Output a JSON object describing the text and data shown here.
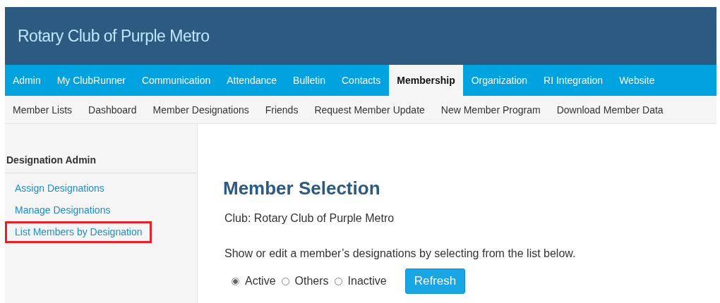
{
  "header": {
    "title": "Rotary Club of Purple Metro"
  },
  "nav": [
    {
      "label": "Admin",
      "selected": false
    },
    {
      "label": "My ClubRunner",
      "selected": false
    },
    {
      "label": "Communication",
      "selected": false
    },
    {
      "label": "Attendance",
      "selected": false
    },
    {
      "label": "Bulletin",
      "selected": false
    },
    {
      "label": "Contacts",
      "selected": false
    },
    {
      "label": "Membership",
      "selected": true
    },
    {
      "label": "Organization",
      "selected": false
    },
    {
      "label": "RI Integration",
      "selected": false
    },
    {
      "label": "Website",
      "selected": false
    }
  ],
  "subnav": [
    "Member Lists",
    "Dashboard",
    "Member Designations",
    "Friends",
    "Request Member Update",
    "New Member Program",
    "Download Member Data"
  ],
  "sidebar": {
    "heading": "Designation Admin",
    "items": [
      {
        "label": "Assign Designations",
        "highlighted": false
      },
      {
        "label": "Manage Designations",
        "highlighted": false
      },
      {
        "label": "List Members by Designation",
        "highlighted": true
      }
    ]
  },
  "main": {
    "title": "Member Selection",
    "club": "Club: Rotary Club of Purple Metro",
    "instructions": "Show or edit a member’s designations by selecting from the list below.",
    "filters": [
      {
        "label": "Active",
        "selected": true
      },
      {
        "label": "Others",
        "selected": false
      },
      {
        "label": "Inactive",
        "selected": false
      }
    ],
    "button": "Refresh"
  }
}
